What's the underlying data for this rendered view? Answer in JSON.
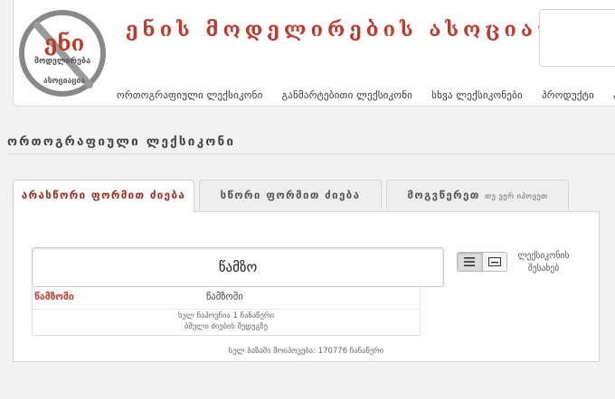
{
  "header": {
    "logo_text_top": "ენი",
    "logo_text_middle": "მოდელირება",
    "logo_text_bottom": "ასოციაცია",
    "site_title": "ენის მოდელირების ასოციაცია",
    "nav": [
      "ორთოგრაფიული ლექსიკონი",
      "განმარტებითი ლექსიკონი",
      "სხვა ლექსიკონები",
      "პროდუქტი",
      "ას"
    ]
  },
  "section_title": "ორთოგრაფიული ლექსიკონი",
  "tabs": {
    "items": [
      {
        "label": "არასწორი ფორმით ძიება",
        "sub": ""
      },
      {
        "label": "სწორი ფორმით ძიება",
        "sub": ""
      },
      {
        "label": "მოგვწერეთ",
        "sub": "თუ ვერ იპოვეთ"
      }
    ]
  },
  "search": {
    "value": "წამზო",
    "about_label": "ლექსიკონის შესახებ"
  },
  "results": {
    "word": "წამზომი",
    "form": "წამზომი",
    "count_text": "სულ ნაპოვნია 1 ჩანაწერი",
    "more_text": "ბმული ძიების შედეგზე"
  },
  "total_text": "სულ ბაზაში მოიპოვება: 170776 ჩანაწერი",
  "colors": {
    "accent": "#a0281c",
    "title_red": "#c0392b"
  }
}
